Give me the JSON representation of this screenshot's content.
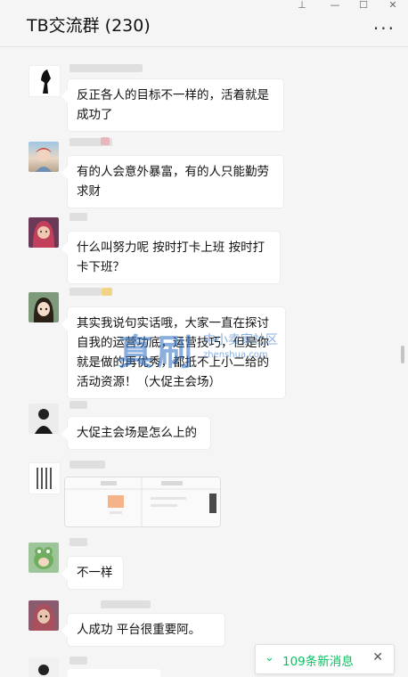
{
  "window": {
    "title": "TB交流群 (230)",
    "controls": {
      "pin": "⊥",
      "minimize": "—",
      "maximize": "☐",
      "close": "✕"
    },
    "more": "···"
  },
  "messages": [
    {
      "text": "反正各人的目标不一样的，活着就是成功了"
    },
    {
      "text": "有的人会意外暴富，有的人只能勤劳求财"
    },
    {
      "text": "什么叫努力呢 按时打卡上班 按时打卡下班？"
    },
    {
      "text": "其实我说句实话哦，大家一直在探讨自我的运营功底，运营技巧，但是你就是做的再优秀，都抵不上小二给的活动资源！（大促主会场）"
    },
    {
      "text": "大促主会场是怎么上的"
    },
    {
      "text": "不一样"
    },
    {
      "text": "人成功 平台很重要阿。"
    }
  ],
  "watermark": {
    "big": "真刷",
    "small": "中小卖家社区",
    "url": "zhenshua.com"
  },
  "new_messages": {
    "label": "109条新消息",
    "close": "✕",
    "chevron": "⌄"
  },
  "colors": {
    "accent": "#07c160",
    "background": "#f5f5f5",
    "bubble": "#ffffff"
  }
}
